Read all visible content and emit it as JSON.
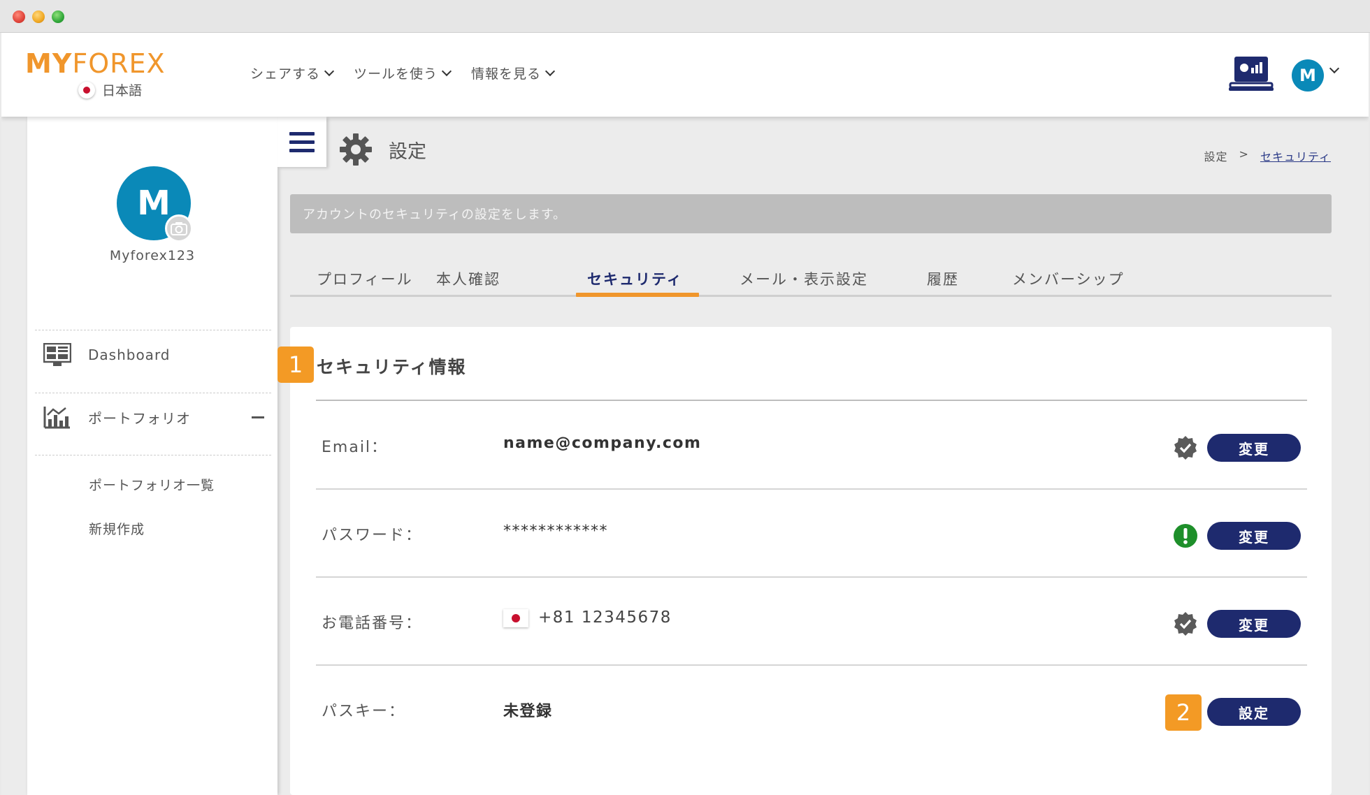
{
  "header": {
    "logo_my": "MY",
    "logo_forex": "FOREX",
    "language": "日本語",
    "nav": [
      "シェアする",
      "ツールを使う",
      "情報を見る"
    ],
    "avatar_initial": "M"
  },
  "sidebar": {
    "avatar_initial": "M",
    "username": "Myforex123",
    "items": [
      {
        "label": "Dashboard",
        "icon": "dashboard-icon"
      },
      {
        "label": "ポートフォリオ",
        "icon": "portfolio-chart-icon"
      }
    ],
    "subitems": [
      "ポートフォリオ一覧",
      "新規作成"
    ]
  },
  "page": {
    "title": "設定",
    "breadcrumb": [
      "設定",
      ">",
      "セキュリティ"
    ],
    "info": "アカウントのセキュリティの設定をします。"
  },
  "tabs": [
    "プロフィール",
    "本人確認",
    "セキュリティ",
    "メール・表示設定",
    "履歴",
    "メンバーシップ"
  ],
  "active_tab": "セキュリティ",
  "security": {
    "badge1": "1",
    "title": "セキュリティ情報",
    "rows": [
      {
        "label": "Email：",
        "value": "name@company.com",
        "status": "verified",
        "button": "変更"
      },
      {
        "label": "パスワード：",
        "value": "************",
        "status": "warning",
        "button": "変更"
      },
      {
        "label": "お電話番号：",
        "value": "+81 12345678",
        "status": "verified",
        "button": "変更"
      },
      {
        "label": "パスキー：",
        "value": "未登録",
        "status": "none",
        "button": "設定"
      }
    ],
    "badge2": "2"
  },
  "colors": {
    "accent": "#f0962c",
    "navy": "#1e2a6e",
    "avatar": "#0a89b8",
    "success": "#1e8f2a"
  }
}
